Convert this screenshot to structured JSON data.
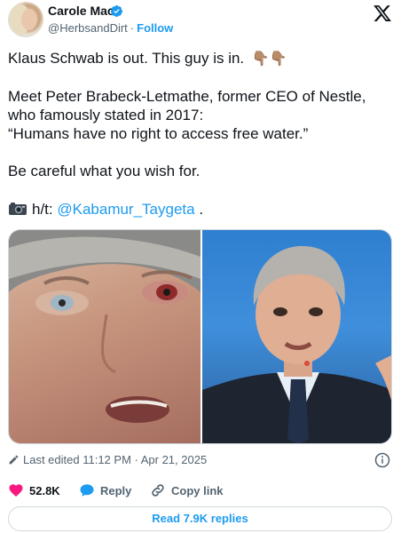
{
  "author": {
    "name": "Carole Mac",
    "handle": "@HerbsandDirt",
    "separator": "·",
    "follow_label": "Follow"
  },
  "tweet": {
    "line1": "Klaus Schwab is out. This guy is in.",
    "line1_emoji": "👇🏽👇🏽",
    "line2": "Meet Peter Brabeck-Letmathe, former CEO of Nestle, who famously stated in 2017:",
    "line3": "“Humans have no right to access free water.”",
    "line4": "Be careful what you wish for.",
    "hat_tip_prefix": "h/t: ",
    "hat_tip_mention": "@Kabamur_Taygeta",
    "hat_tip_suffix": " ."
  },
  "meta": {
    "edited_label": "Last edited 11:12 PM · Apr 21, 2025"
  },
  "actions": {
    "like_count": "52.8K",
    "reply_label": "Reply",
    "copy_label": "Copy link",
    "read_replies_label": "Read 7.9K replies"
  },
  "colors": {
    "accent": "#1d9bf0",
    "like": "#f91880",
    "muted": "#536471",
    "text": "#0f1419"
  },
  "icons": [
    "verified-badge-icon",
    "x-logo-icon",
    "camera-icon",
    "pencil-icon",
    "info-icon",
    "heart-icon",
    "reply-bubble-icon",
    "link-icon"
  ]
}
